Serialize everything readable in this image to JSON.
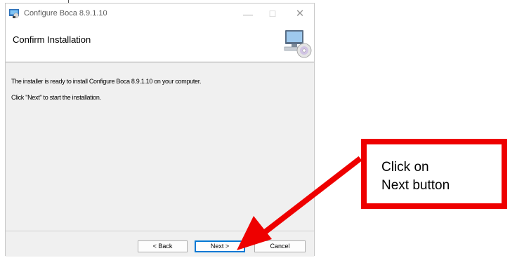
{
  "window": {
    "title": "Configure Boca 8.9.1.10",
    "controls": {
      "minimize": "—",
      "maximize": "☐",
      "close": "✕"
    }
  },
  "banner": {
    "heading": "Confirm Installation",
    "icon": "computer-disc-icon"
  },
  "content": {
    "line1": "The installer is ready to install Configure Boca 8.9.1.10 on your computer.",
    "line2": "Click \"Next\" to start the installation."
  },
  "buttons": {
    "back": "< Back",
    "next": "Next >",
    "cancel": "Cancel"
  },
  "annotation": {
    "callout_text": "Click on\nNext button",
    "color": "#ee0000"
  }
}
